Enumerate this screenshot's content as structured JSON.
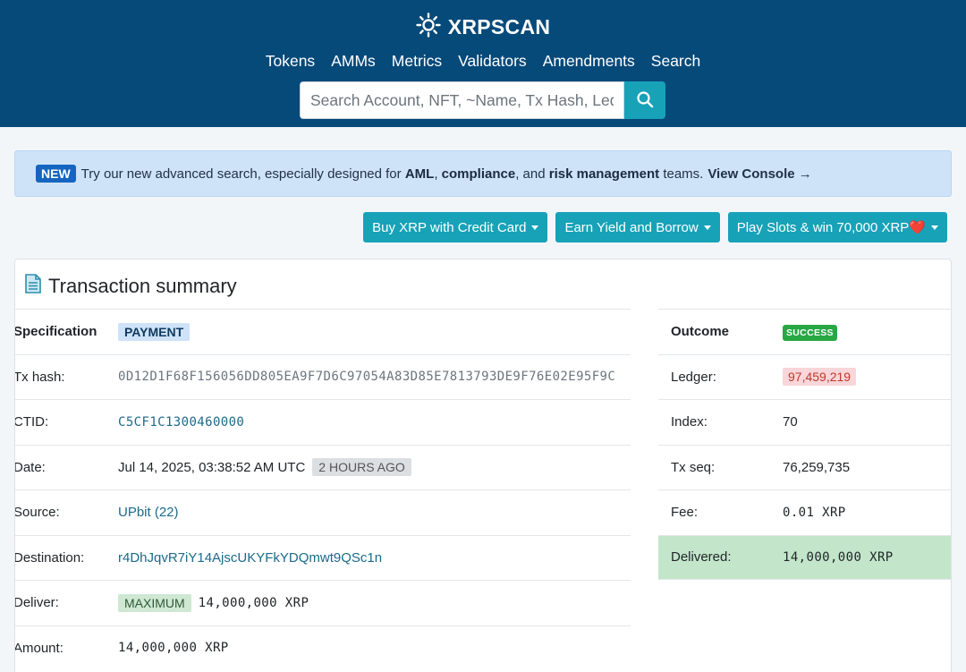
{
  "header": {
    "logo_text": "XRPSCAN",
    "nav": [
      "Tokens",
      "AMMs",
      "Metrics",
      "Validators",
      "Amendments",
      "Search"
    ],
    "search_placeholder": "Search Account, NFT, ~Name, Tx Hash, Ledger"
  },
  "announcement": {
    "badge": "NEW",
    "text_1": "Try our new advanced search, especially designed for",
    "bold_1": "AML",
    "sep_1": ",",
    "bold_2": "compliance",
    "sep_2": ", and",
    "bold_3": "risk management",
    "text_2": "teams.",
    "link": "View Console →"
  },
  "actions": {
    "buy": "Buy XRP with Credit Card",
    "earn": "Earn Yield and Borrow",
    "play": "Play Slots & win 70,000 XRP❤️"
  },
  "card": {
    "title": "Transaction summary"
  },
  "details": {
    "specification_label": "Specification",
    "specification_value": "PAYMENT",
    "tx_hash_label": "Tx hash:",
    "tx_hash_value": "0D12D1F68F156056DD805EA9F7D6C97054A83D85E7813793DE9F76E02E95F9C",
    "ctid_label": "CTID:",
    "ctid_value": "C5CF1C1300460000",
    "date_label": "Date:",
    "date_value": "Jul 14, 2025, 03:38:52 AM UTC",
    "date_ago": "2 HOURS AGO",
    "source_label": "Source:",
    "source_value": "UPbit (22)",
    "destination_label": "Destination:",
    "destination_value": "r4DhJqvR7iY14AjscUKYFkYDQmwt9QSc1n",
    "deliver_label": "Deliver:",
    "deliver_tag": "MAXIMUM",
    "deliver_value": "14,000,000 XRP",
    "amount_label": "Amount:",
    "amount_value": "14,000,000 XRP"
  },
  "outcome": {
    "outcome_label": "Outcome",
    "outcome_value": "SUCCESS",
    "ledger_label": "Ledger:",
    "ledger_value": "97,459,219",
    "index_label": "Index:",
    "index_value": "70",
    "txseq_label": "Tx seq:",
    "txseq_value": "76,259,735",
    "fee_label": "Fee:",
    "fee_value": "0.01 XRP",
    "delivered_label": "Delivered:",
    "delivered_value": "14,000,000 XRP"
  },
  "colors": {
    "header_bg": "#064a7a",
    "accent": "#17a2b8",
    "success": "#28a745",
    "delivered_bg": "#c3e6cb"
  }
}
